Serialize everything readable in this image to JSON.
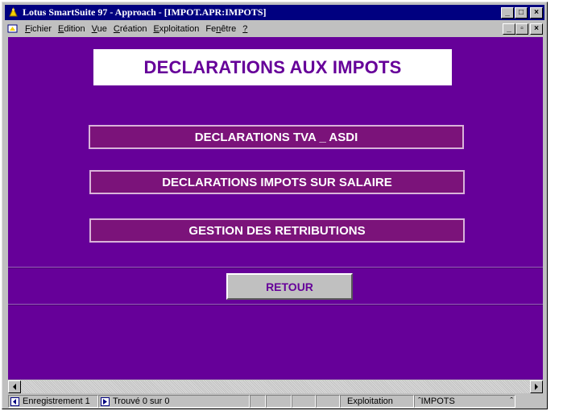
{
  "window": {
    "title": "Lotus SmartSuite 97  - Approach - [IMPOT.APR:IMPOTS]",
    "controls": {
      "minimize": "_",
      "restore": "□",
      "close": "×"
    }
  },
  "menu": {
    "items": [
      {
        "mnemonic": "F",
        "rest": "ichier"
      },
      {
        "mnemonic": "E",
        "rest": "dition"
      },
      {
        "mnemonic": "V",
        "rest": "ue"
      },
      {
        "mnemonic": "C",
        "rest": "réation"
      },
      {
        "mnemonic": "E",
        "rest": "xploitation"
      },
      {
        "pre": "Fe",
        "mnemonic": "n",
        "rest": "être"
      },
      {
        "mnemonic": "?",
        "rest": ""
      }
    ],
    "doc_controls": {
      "minimize": "_",
      "restore": "▫",
      "close": "×"
    }
  },
  "form": {
    "heading": "DECLARATIONS AUX IMPOTS",
    "buttons": {
      "tva": "DECLARATIONS TVA _ ASDI",
      "salaire": "DECLARATIONS  IMPOTS SUR SALAIRE",
      "retributions": "GESTION DES RETRIBUTIONS"
    },
    "retour": "RETOUR"
  },
  "statusbar": {
    "record": "Enregistrement 1",
    "found": "Trouvé 0 sur 0",
    "mode": "Exploitation",
    "view": "IMPOTS"
  },
  "colors": {
    "background": "#660099",
    "button": "#7b137a",
    "title_bar": "#000080"
  }
}
